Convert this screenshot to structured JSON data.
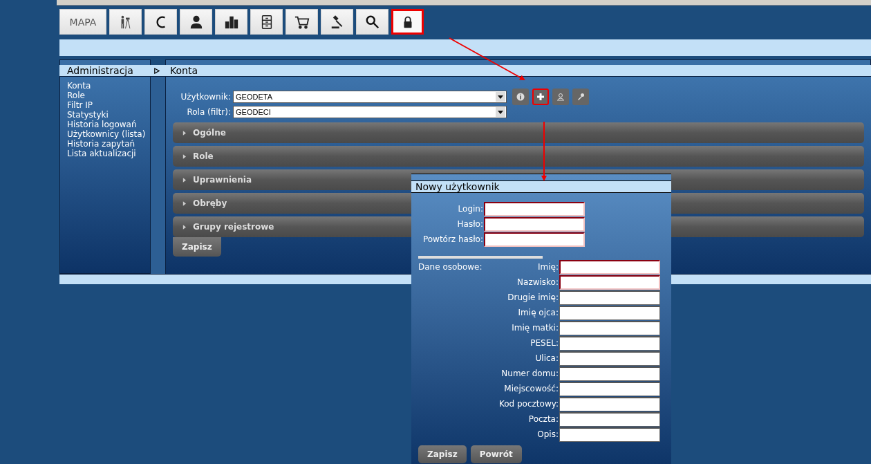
{
  "toolbar": {
    "items": [
      {
        "kind": "text",
        "label": "MAPA",
        "highlighted": false
      },
      {
        "kind": "icon",
        "highlighted": false
      },
      {
        "kind": "icon",
        "highlighted": false
      },
      {
        "kind": "icon",
        "highlighted": false
      },
      {
        "kind": "icon",
        "highlighted": false
      },
      {
        "kind": "icon",
        "highlighted": false
      },
      {
        "kind": "icon",
        "highlighted": false
      },
      {
        "kind": "icon",
        "highlighted": false
      },
      {
        "kind": "icon",
        "highlighted": false
      },
      {
        "kind": "icon",
        "highlighted": true
      }
    ]
  },
  "sidebar": {
    "title": "Administracja",
    "items": [
      "Konta",
      "Role",
      "Filtr IP",
      "Statystyki",
      "Historia logowań",
      "Użytkownicy (lista)",
      "Historia zapytań",
      "Lista aktualizacji"
    ]
  },
  "content": {
    "title": "Konta",
    "filters": [
      {
        "label": "Użytkownik:",
        "value": "GEODETA"
      },
      {
        "label": "Rola (filtr):",
        "value": "GEODECI"
      }
    ],
    "actions": [
      {
        "highlighted": false
      },
      {
        "highlighted": true
      },
      {
        "highlighted": false
      },
      {
        "highlighted": false
      }
    ],
    "sections": [
      {
        "label": "Ogólne",
        "expanded": false
      },
      {
        "label": "Role",
        "expanded": false
      },
      {
        "label": "Uprawnienia",
        "expanded": false
      },
      {
        "label": "Obręby",
        "expanded": false
      },
      {
        "label": "Grupy rejestrowe",
        "expanded": false
      }
    ],
    "save_button": "Zapisz"
  },
  "dialog": {
    "title": "Nowy użytkownik",
    "account_fields": [
      {
        "label": "Login:",
        "required": true
      },
      {
        "label": "Hasło:",
        "required": true
      },
      {
        "label": "Powtórz hasło:",
        "required": true
      }
    ],
    "personal_label": "Dane osobowe:",
    "personal_fields": [
      {
        "label": "Imię:",
        "required": true
      },
      {
        "label": "Nazwisko:",
        "required": true
      },
      {
        "label": "Drugie imię:",
        "required": false
      },
      {
        "label": "Imię ojca:",
        "required": false
      },
      {
        "label": "Imię matki:",
        "required": false
      },
      {
        "label": "PESEL:",
        "required": false
      },
      {
        "label": "Ulica:",
        "required": false
      },
      {
        "label": "Numer domu:",
        "required": false
      },
      {
        "label": "Miejscowość:",
        "required": false
      },
      {
        "label": "Kod pocztowy:",
        "required": false
      },
      {
        "label": "Poczta:",
        "required": false
      },
      {
        "label": "Opis:",
        "required": false
      }
    ],
    "buttons": [
      "Zapisz",
      "Powrót"
    ]
  }
}
